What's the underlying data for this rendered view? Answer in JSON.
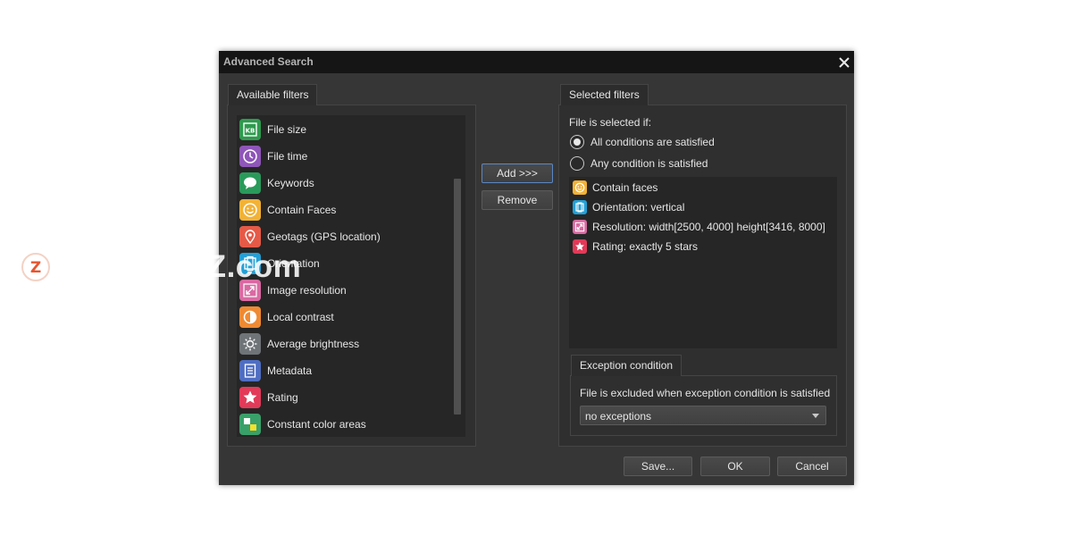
{
  "window": {
    "title": "Advanced Search"
  },
  "available": {
    "tab_label": "Available filters",
    "filters": [
      {
        "label": "File size",
        "icon": "file-size-icon",
        "color": "#2f9a4e"
      },
      {
        "label": "File time",
        "icon": "clock-icon",
        "color": "#8e56b8"
      },
      {
        "label": "Keywords",
        "icon": "speech-bubble-icon",
        "color": "#2a9a5a"
      },
      {
        "label": "Contain Faces",
        "icon": "face-icon",
        "color": "#f2b236"
      },
      {
        "label": "Geotags (GPS location)",
        "icon": "location-pin-icon",
        "color": "#e55a47"
      },
      {
        "label": "Orientation",
        "icon": "orientation-icon",
        "color": "#22a0d6"
      },
      {
        "label": "Image resolution",
        "icon": "resize-arrows-icon",
        "color": "#d96aa2"
      },
      {
        "label": "Local contrast",
        "icon": "contrast-icon",
        "color": "#ef8a33"
      },
      {
        "label": "Average brightness",
        "icon": "sun-icon",
        "color": "#6f7478"
      },
      {
        "label": "Metadata",
        "icon": "document-lines-icon",
        "color": "#4f6ec2"
      },
      {
        "label": "Rating",
        "icon": "star-icon",
        "color": "#e23a58"
      },
      {
        "label": "Constant color areas",
        "icon": "color-blocks-icon",
        "color": "#3aa06a"
      }
    ]
  },
  "actions": {
    "add_label": "Add >>>",
    "remove_label": "Remove"
  },
  "selected": {
    "tab_label": "Selected filters",
    "intro": "File is selected if:",
    "radio_all": "All conditions are satisfied",
    "radio_any": "Any condition is satisfied",
    "radio_selected": "all",
    "conditions": [
      {
        "label": "Contain faces",
        "icon": "face-icon",
        "color": "#f2b236"
      },
      {
        "label": "Orientation: vertical",
        "icon": "orientation-icon",
        "color": "#22a0d6"
      },
      {
        "label": "Resolution: width[2500, 4000] height[3416, 8000]",
        "icon": "resize-arrows-icon",
        "color": "#d96aa2"
      },
      {
        "label": "Rating: exactly 5 stars",
        "icon": "star-icon",
        "color": "#e23a58"
      }
    ]
  },
  "exception": {
    "tab_label": "Exception condition",
    "text": "File is excluded when exception condition is satisfied",
    "select_value": "no exceptions"
  },
  "footer": {
    "save_label": "Save...",
    "ok_label": "OK",
    "cancel_label": "Cancel"
  },
  "watermark": {
    "text": "www.MacZ.com",
    "logo_letter": "Z"
  }
}
